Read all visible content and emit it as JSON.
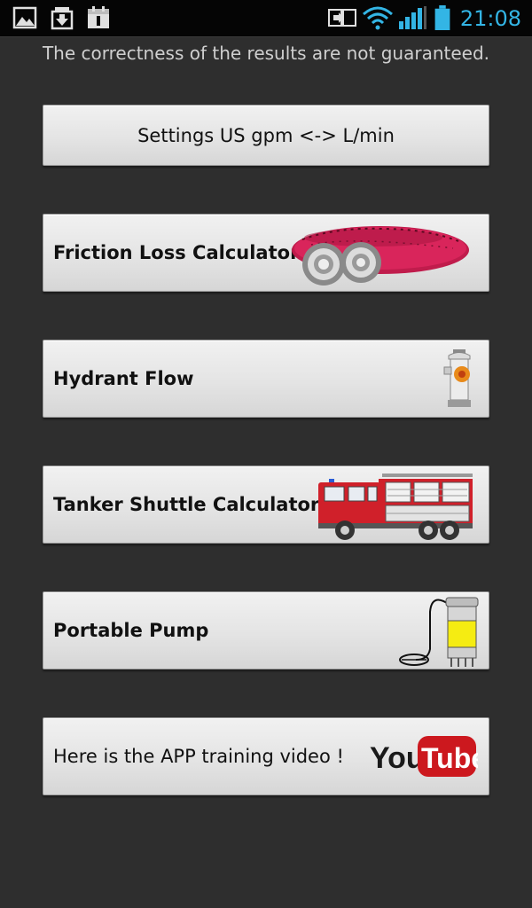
{
  "status_bar": {
    "time": "21:08",
    "left_icons": [
      "gallery-icon",
      "download-icon",
      "calendar-icon"
    ],
    "right_icons": [
      "screen-mirroring-icon",
      "wifi-icon",
      "signal-icon",
      "battery-icon"
    ],
    "accent_color": "#33b5e5"
  },
  "disclaimer": "The correctness of the results are not guaranteed.",
  "menu": {
    "settings_label": "Settings US gpm <-> L/min",
    "friction_loss_label": "Friction Loss Calculator",
    "hydrant_flow_label": "Hydrant Flow",
    "tanker_shuttle_label": "Tanker Shuttle Calculator",
    "portable_pump_label": "Portable Pump",
    "training_video_label": "Here is the APP training video !"
  },
  "youtube_logo": {
    "you": "You",
    "tube": "Tube"
  },
  "colors": {
    "background": "#2e2e2e",
    "button_face": "#e4e4e4",
    "hose_red": "#d6245a",
    "youtube_red": "#cc181e"
  }
}
